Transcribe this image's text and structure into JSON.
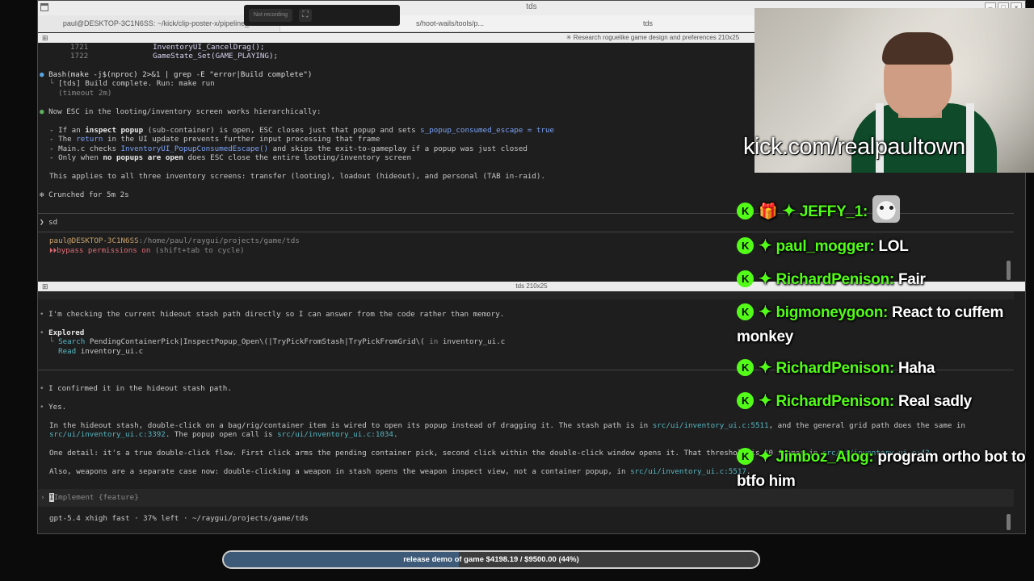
{
  "window": {
    "title": "tds",
    "recording_label": "Not recording",
    "tabs": [
      "paul@DESKTOP-3C1N6SS: ~/kick/clip-poster-x/pipeline_ui",
      "tds",
      "s/hoot-wails/tools/p..."
    ]
  },
  "top_pane": {
    "header": "✳ Research roguelike game design and preferences 210x25",
    "code_lines": [
      {
        "num": "1721",
        "code": "InventoryUI_CancelDrag();"
      },
      {
        "num": "1722",
        "code": "GameState_Set(GAME_PLAYING);"
      }
    ],
    "bash_cmd": "Bash(make -j$(nproc) 2>&1 | grep -E \"error|Build complete\")",
    "bash_out1": "[tds] Build complete. Run: make run",
    "bash_out2": "(timeout 2m)",
    "summary": "Now ESC in the looting/inventory screen works hierarchically:",
    "bullet1_a": "- If an ",
    "bullet1_b": "inspect popup",
    "bullet1_c": " (sub-container) is open, ESC closes just that popup and sets ",
    "bullet1_d": "s_popup_consumed_escape = true",
    "bullet2_a": "- The ",
    "bullet2_b": "return",
    "bullet2_c": " in the UI update prevents further input processing that frame",
    "bullet3_a": "- Main.c checks ",
    "bullet3_b": "InventoryUI_PopupConsumedEscape()",
    "bullet3_c": " and skips the exit-to-gameplay if a popup was just closed",
    "bullet4_a": "- Only when ",
    "bullet4_b": "no popups are open",
    "bullet4_c": " does ESC close the entire looting/inventory screen",
    "applies": "This applies to all three inventory screens: transfer (looting), loadout (hideout), and personal (TAB in-raid).",
    "crunched": "✻ Crunched for 5m 2s",
    "prompt": "sd",
    "path_user": "paul@DESKTOP-3C1N6SS",
    "path_dir": ":/home/paul/raygui/projects/game/tds",
    "bypass": "bypass permissions on",
    "bypass_hint": " (shift+tab to cycle)"
  },
  "bottom_pane": {
    "header": "tds 210x25",
    "line1": "I'm checking the current hideout stash path directly so I can answer from the code rather than memory.",
    "explored": "Explored",
    "search_label": "Search",
    "search_q": "PendingContainerPick|InspectPopup_Open\\(|TryPickFromStash|TryPickFromGrid\\(",
    "search_in": " in ",
    "search_file": "inventory_ui.c",
    "read_label": "Read",
    "read_file": "inventory_ui.c",
    "confirmed": "I confirmed it in the hideout stash path.",
    "yes": "Yes.",
    "para1_a": "In the hideout stash, double-click on a bag/rig/container item is wired to open its popup instead of dragging it. The stash path is in ",
    "para1_link": "src/ui/inventory_ui.c:5511",
    "para1_b": ", and the general grid path does the same in",
    "para1_link2": "src/ui/inventory_ui.c:3392",
    "para1_c": ". The popup open call is ",
    "para1_link3": "src/ui/inventory_ui.c:1034",
    "para1_d": ".",
    "para2_a": "One detail: it's a true double-click flow. First click arms the pending container pick, second click within the double-click window opens it. That threshold is 40 frames in ",
    "para2_link": "src/ui/inventory_ui.c:42",
    "para2_b": ".",
    "para3_a": "Also, weapons are a separate case now: double-clicking a weapon in stash opens the weapon inspect view, not a container popup, in ",
    "para3_link": "src/ui/inventory_ui.c:5517",
    "para3_b": ".",
    "input_placeholder": "Implement {feature}",
    "status": "gpt-5.4 xhigh fast · 37% left · ~/raygui/projects/game/tds"
  },
  "overlay": {
    "channel": "kick.com/realpaultown",
    "chat": [
      {
        "user": "JEFFY_1:",
        "text": "",
        "gift": true,
        "emote": true
      },
      {
        "user": "paul_mogger:",
        "text": "LOL"
      },
      {
        "user": "RichardPenison:",
        "text": "Fair"
      },
      {
        "user": "bigmoneygoon:",
        "text": "React to cuffem monkey"
      },
      {
        "user": "RichardPenison:",
        "text": "Haha"
      },
      {
        "user": "RichardPenison:",
        "text": "Real sadly"
      },
      {
        "user": "Jimboz_Alog:",
        "text": "program ortho bot to btfo him"
      }
    ],
    "goal_text": "release demo of game $4198.19 / $9500.00 (44%)",
    "goal_progress": 0.44,
    "accent": "#53fc18"
  }
}
